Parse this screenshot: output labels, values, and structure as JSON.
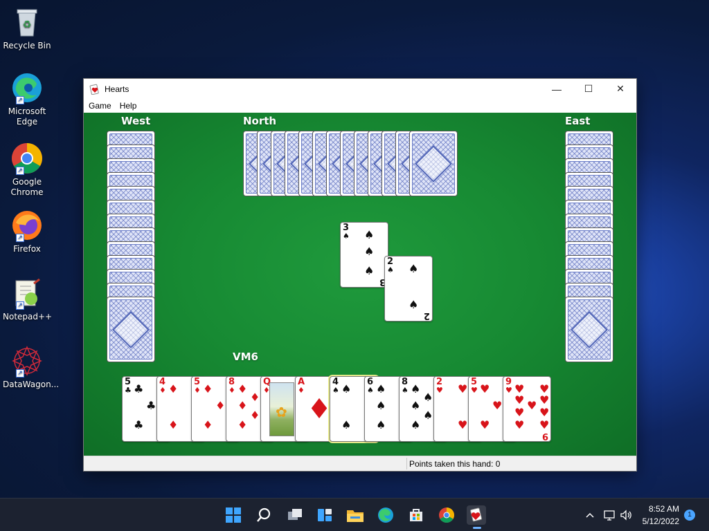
{
  "desktop": {
    "icons": [
      {
        "label": "Recycle Bin"
      },
      {
        "label": "Microsoft Edge"
      },
      {
        "label": "Google Chrome"
      },
      {
        "label": "Firefox"
      },
      {
        "label": "Notepad++"
      },
      {
        "label": "DataWagon..."
      }
    ]
  },
  "window": {
    "title": "Hearts",
    "menu": [
      "Game",
      "Help"
    ],
    "controls": {
      "minimize": "—",
      "maximize": "☐",
      "close": "✕"
    }
  },
  "game": {
    "players": {
      "west": "West",
      "north": "North",
      "east": "East",
      "south": "VM6"
    },
    "west_card_count": 13,
    "north_card_count": 13,
    "east_card_count": 13,
    "trick": [
      {
        "rank": "3",
        "suit": "♠",
        "color": "black",
        "by": "north"
      },
      {
        "rank": "2",
        "suit": "♠",
        "color": "black",
        "by": "east"
      }
    ],
    "hand": [
      {
        "rank": "5",
        "suit": "♣",
        "color": "black"
      },
      {
        "rank": "4",
        "suit": "♦",
        "color": "red"
      },
      {
        "rank": "5",
        "suit": "♦",
        "color": "red"
      },
      {
        "rank": "8",
        "suit": "♦",
        "color": "red"
      },
      {
        "rank": "Q",
        "suit": "♦",
        "color": "red"
      },
      {
        "rank": "A",
        "suit": "♦",
        "color": "red"
      },
      {
        "rank": "4",
        "suit": "♠",
        "color": "black",
        "selected": true
      },
      {
        "rank": "6",
        "suit": "♠",
        "color": "black"
      },
      {
        "rank": "8",
        "suit": "♠",
        "color": "black"
      },
      {
        "rank": "2",
        "suit": "♥",
        "color": "red"
      },
      {
        "rank": "5",
        "suit": "♥",
        "color": "red"
      },
      {
        "rank": "9",
        "suit": "♥",
        "color": "red"
      }
    ]
  },
  "status": {
    "text": "Points taken this hand: 0"
  },
  "taskbar": {
    "apps": [
      "start-icon",
      "search-icon",
      "task-view-icon",
      "widgets-icon",
      "file-explorer-icon",
      "edge-icon",
      "store-icon",
      "chrome-icon",
      "hearts-icon"
    ],
    "time": "8:52 AM",
    "date": "5/12/2022",
    "notifications": "1"
  }
}
